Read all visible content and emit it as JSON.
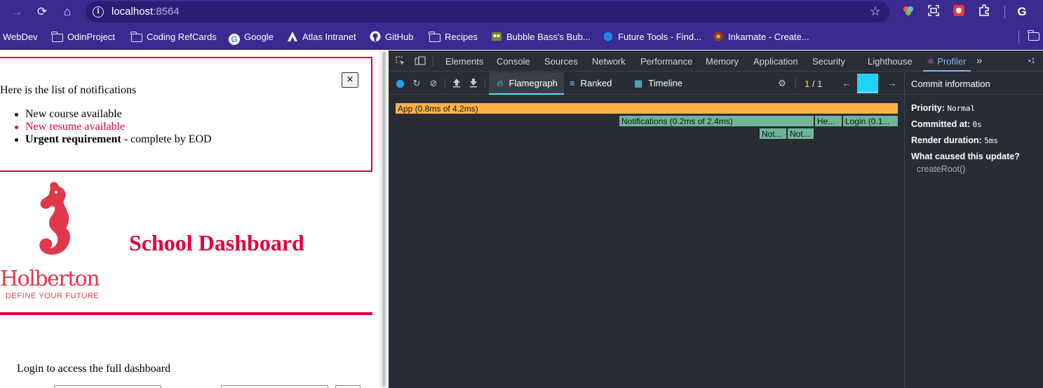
{
  "browser": {
    "url_host": "localhost",
    "url_port": ":8564",
    "extensions_icons": [
      "colorful-extension-icon",
      "screenshot-icon",
      "red-extension-icon",
      "puzzle-icon",
      "google-icon"
    ],
    "google_label": "G"
  },
  "bookmarks": [
    {
      "label": "WebDev",
      "icon": "none"
    },
    {
      "label": "OdinProject",
      "icon": "folder-icon"
    },
    {
      "label": "Coding RefCards",
      "icon": "folder-icon"
    },
    {
      "label": "Google",
      "icon": "google-icon"
    },
    {
      "label": "Atlas Intranet",
      "icon": "atlas-icon"
    },
    {
      "label": "GitHub",
      "icon": "github-icon"
    },
    {
      "label": "Recipes",
      "icon": "folder-icon"
    },
    {
      "label": "Bubble Bass's Bub...",
      "icon": "bubble-bass-icon"
    },
    {
      "label": "Future Tools - Find...",
      "icon": "future-tools-icon"
    },
    {
      "label": "Inkarnate - Create...",
      "icon": "inkarnate-icon"
    }
  ],
  "page": {
    "close_label": "×",
    "notifications_title": "Here is the list of notifications",
    "notifications": [
      {
        "text": "New course available",
        "type": "default"
      },
      {
        "text": "New resume available",
        "type": "urgent"
      },
      {
        "strong": "Urgent requirement",
        "rest": " - complete by EOD",
        "type": "html"
      }
    ],
    "logo_word": "Holberton",
    "logo_tagline": "DEFINE YOUR FUTURE",
    "dashboard_title": "School Dashboard",
    "login_text": "Login to access the full dashboard",
    "colors": {
      "accent": "#e1003c",
      "logo": "#e1374a"
    }
  },
  "devtools": {
    "tabs": [
      "Elements",
      "Console",
      "Sources",
      "Network",
      "Performance",
      "Memory",
      "Application",
      "Security",
      "Lighthouse",
      "Profiler"
    ],
    "active_tab": "Profiler",
    "more_tabs": "»",
    "issues_count": "1",
    "profiler_tabs": [
      "Flamegraph",
      "Ranked",
      "Timeline"
    ],
    "commit_current": "1",
    "commit_sep": "/",
    "commit_total": "1",
    "flamegraph": [
      {
        "label": "App (0.8ms of 4.2ms)",
        "kind": "app"
      },
      {
        "label": "Notifications (0.2ms of 2.4ms)",
        "kind": "teal"
      },
      {
        "label": "He...",
        "kind": "teal"
      },
      {
        "label": "Login (0.1...",
        "kind": "teal"
      },
      {
        "label": "Not...",
        "kind": "teal"
      },
      {
        "label": "Not...",
        "kind": "teal"
      }
    ],
    "commit_info": {
      "heading": "Commit information",
      "priority_label": "Priority:",
      "priority_value": "Normal",
      "committed_label": "Committed at:",
      "committed_value": "0s",
      "render_label": "Render duration:",
      "render_value": "5ms",
      "cause_label": "What caused this update?",
      "cause_value": "createRoot()"
    },
    "colors": {
      "bg": "#282c34",
      "app_node": "#ffb347",
      "child_node": "#6eb59a",
      "react_blue": "#61dafb"
    }
  }
}
